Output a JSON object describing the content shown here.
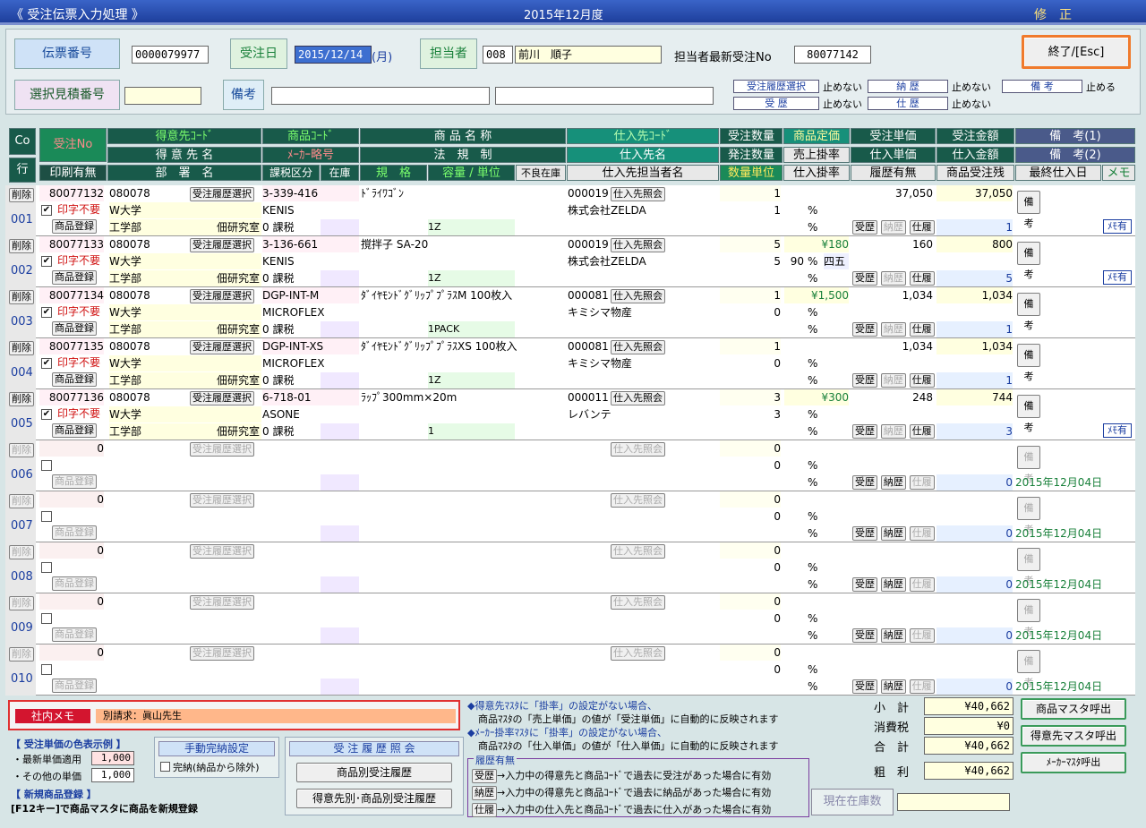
{
  "window": {
    "title": "《 受注伝票入力処理 》",
    "period": "2015年12月度",
    "mode": "修　正"
  },
  "header": {
    "slip_label": "伝票番号",
    "slip_value": "0000079977",
    "order_date_label": "受注日",
    "order_date_value": "2015/12/14",
    "weekday": "(月)",
    "staff_label": "担当者",
    "staff_code": "008",
    "staff_name": "前川　順子",
    "latest_label": "担当者最新受注No",
    "latest_value": "80077142",
    "exit_button": "終了/[Esc]",
    "quote_label": "選択見積番号",
    "quote_value": "",
    "remarks_label": "備考",
    "remarks1": "",
    "remarks2": "",
    "opt1_label": "受注履歴選択",
    "opt1_value": "止めない",
    "opt2_label": "納 歴",
    "opt2_value": "止めない",
    "opt3_label": "備 考",
    "opt3_value": "止める",
    "opt4_label": "受 歴",
    "opt4_value": "止めない",
    "opt5_label": "仕 歴",
    "opt5_value": "止めない"
  },
  "columns": {
    "co": "Co",
    "gyo": "行",
    "order_no": "受注No",
    "print": "印刷有無",
    "cust_code": "得意先ｺｰﾄﾞ",
    "cust_name": "得 意 先 名",
    "dept": "部　署　名",
    "prod_code": "商品ｺｰﾄﾞ",
    "maker": "ﾒｰｶｰ略号",
    "tax": "課税区分",
    "stock": "在庫",
    "prod_name": "商 品 名 称",
    "law": "法　規　制",
    "spec": "規　格",
    "qty_unit": "容量 / 単位",
    "defect": "不良在庫",
    "sup_code": "仕入先ｺｰﾄﾞ",
    "sup_name": "仕入先名",
    "sup_person": "仕入先担当者名",
    "order_qty": "受注数量",
    "place_qty": "発注数量",
    "qty_unit2": "数量単位",
    "list_price": "商品定価",
    "sale_rate": "売上掛率",
    "buy_rate": "仕入掛率",
    "unit_price": "受注単価",
    "buy_price": "仕入単価",
    "hist": "履歴有無",
    "amount": "受注金額",
    "buy_amount": "仕入金額",
    "remain": "商品受注残",
    "memo1": "備　考(1)",
    "memo2": "備　考(2)",
    "last_buy": "最終仕入日",
    "memo": "メモ"
  },
  "labels": {
    "delete": "削除",
    "noprint": "印字不要",
    "register": "商品登録",
    "hist_select": "受注履歴選択",
    "sup_inquiry": "仕入先照会",
    "remarks_btn": "備考",
    "pct": "%",
    "h_ju": "受歴",
    "h_no": "納歴",
    "h_shi": "仕履",
    "memo_yes": "ﾒﾓ有"
  },
  "rows": [
    {
      "line": "001",
      "order_no": "80077132",
      "cust_code": "080078",
      "cust_name": "W大学",
      "dept": "工学部",
      "lab": "佃研究室",
      "prod_code": "3-339-416",
      "maker": "KENIS",
      "tax": "0 課税",
      "prod_name": "ﾄﾞﾗｲﾜｺﾞﾝ",
      "spec_qty": "1Z",
      "sup_code": "000019",
      "sup_name": "株式会社ZELDA",
      "oq": "1",
      "pq": "1",
      "list": "",
      "rate": "",
      "uprice": "37,050",
      "amount": "37,050",
      "remain": "1",
      "last": "",
      "memo": "ﾒﾓ有",
      "checked": true
    },
    {
      "line": "002",
      "order_no": "80077133",
      "cust_code": "080078",
      "cust_name": "W大学",
      "dept": "工学部",
      "lab": "佃研究室",
      "prod_code": "3-136-661",
      "maker": "KENIS",
      "tax": "0 課税",
      "prod_name": "撹拌子 SA-20",
      "spec_qty": "1Z",
      "sup_code": "000019",
      "sup_name": "株式会社ZELDA",
      "oq": "5",
      "pq": "5",
      "list": "¥180",
      "rate": "90",
      "round": "四五",
      "uprice": "160",
      "amount": "800",
      "remain": "5",
      "last": "",
      "memo": "ﾒﾓ有",
      "checked": true
    },
    {
      "line": "003",
      "order_no": "80077134",
      "cust_code": "080078",
      "cust_name": "W大学",
      "dept": "工学部",
      "lab": "佃研究室",
      "prod_code": "DGP-INT-M",
      "maker": "MICROFLEX",
      "tax": "0 課税",
      "prod_name": "ﾀﾞｲﾔﾓﾝﾄﾞｸﾞﾘｯﾌﾟﾌﾟﾗｽM 100枚入",
      "spec_qty": "1PACK",
      "sup_code": "000081",
      "sup_name": "キミシマ物産",
      "oq": "1",
      "pq": "0",
      "list": "¥1,500",
      "rate": "",
      "uprice": "1,034",
      "amount": "1,034",
      "remain": "1",
      "last": "",
      "memo": "",
      "checked": true
    },
    {
      "line": "004",
      "order_no": "80077135",
      "cust_code": "080078",
      "cust_name": "W大学",
      "dept": "工学部",
      "lab": "佃研究室",
      "prod_code": "DGP-INT-XS",
      "maker": "MICROFLEX",
      "tax": "0 課税",
      "prod_name": "ﾀﾞｲﾔﾓﾝﾄﾞｸﾞﾘｯﾌﾟﾌﾟﾗｽXS 100枚入",
      "spec_qty": "1Z",
      "sup_code": "000081",
      "sup_name": "キミシマ物産",
      "oq": "1",
      "pq": "0",
      "list": "",
      "rate": "",
      "uprice": "1,034",
      "amount": "1,034",
      "remain": "1",
      "last": "",
      "memo": "",
      "checked": true
    },
    {
      "line": "005",
      "order_no": "80077136",
      "cust_code": "080078",
      "cust_name": "W大学",
      "dept": "工学部",
      "lab": "佃研究室",
      "prod_code": "6-718-01",
      "maker": "ASONE",
      "tax": "0 課税",
      "prod_name": "ﾗｯﾌﾟ300mm×20m",
      "spec_qty": "1",
      "sup_code": "000011",
      "sup_name": "レバンテ",
      "oq": "3",
      "pq": "3",
      "list": "¥300",
      "rate": "",
      "uprice": "248",
      "amount": "744",
      "remain": "3",
      "last": "",
      "memo": "ﾒﾓ有",
      "checked": true
    },
    {
      "line": "006",
      "order_no": "0",
      "oq": "0",
      "pq": "0",
      "remain": "0",
      "last": "2015年12月04日",
      "empty": true
    },
    {
      "line": "007",
      "order_no": "0",
      "oq": "0",
      "pq": "0",
      "remain": "0",
      "last": "2015年12月04日",
      "empty": true
    },
    {
      "line": "008",
      "order_no": "0",
      "oq": "0",
      "pq": "0",
      "remain": "0",
      "last": "2015年12月04日",
      "empty": true
    },
    {
      "line": "009",
      "order_no": "0",
      "oq": "0",
      "pq": "0",
      "remain": "0",
      "last": "2015年12月04日",
      "empty": true
    },
    {
      "line": "010",
      "order_no": "0",
      "oq": "0",
      "pq": "0",
      "remain": "0",
      "last": "2015年12月04日",
      "empty": true
    }
  ],
  "footer": {
    "memo_label": "社内メモ",
    "memo_value": "別請求：眞山先生",
    "color_title": "【 受注単価の色表示例 】",
    "latest_price": "・最新単価適用",
    "latest_price_val": "1,000",
    "other_price": "・その他の単価",
    "other_price_val": "1,000",
    "new_prod_title": "【 新規商品登録 】",
    "new_prod_desc": "[F12キー]で商品マスタに商品を新規登録",
    "manual_label": "手動完納設定",
    "complete_check": "完納(納品から除外)",
    "history_label": "受 注 履 歴 照 会",
    "hist_btn1": "商品別受注履歴",
    "hist_btn2": "得意先別･商品別受注履歴",
    "note1a": "◆得意先ﾏｽﾀに「掛率」の設定がない場合、",
    "note1b": "商品ﾏｽﾀの「売上単価」の値が「受注単価」に自動的に反映されます",
    "note2a": "◆ﾒｰｶｰ掛率ﾏｽﾀに「掛率」の設定がない場合、",
    "note2b": "商品ﾏｽﾀの「仕入単価」の値が「仕入単価」に自動的に反映されます",
    "hist_title": "履歴有無",
    "leg1": "→入力中の得意先と商品ｺｰﾄﾞで過去に受注があった場合に有効",
    "leg2": "→入力中の得意先と商品ｺｰﾄﾞで過去に納品があった場合に有効",
    "leg3": "→入力中の仕入先と商品ｺｰﾄﾞで過去に仕入があった場合に有効",
    "subtotal_label": "小　計",
    "subtotal": "¥40,662",
    "tax_label": "消費税",
    "tax": "¥0",
    "total_label": "合　計",
    "total": "¥40,662",
    "gross_label": "粗　利",
    "gross": "¥40,662",
    "stock_label": "現在在庫数",
    "stock_value": "",
    "btn_prod": "商品マスタ呼出",
    "btn_cust": "得意先マスタ呼出",
    "btn_maker": "ﾒｰｶｰﾏｽﾀ呼出"
  }
}
